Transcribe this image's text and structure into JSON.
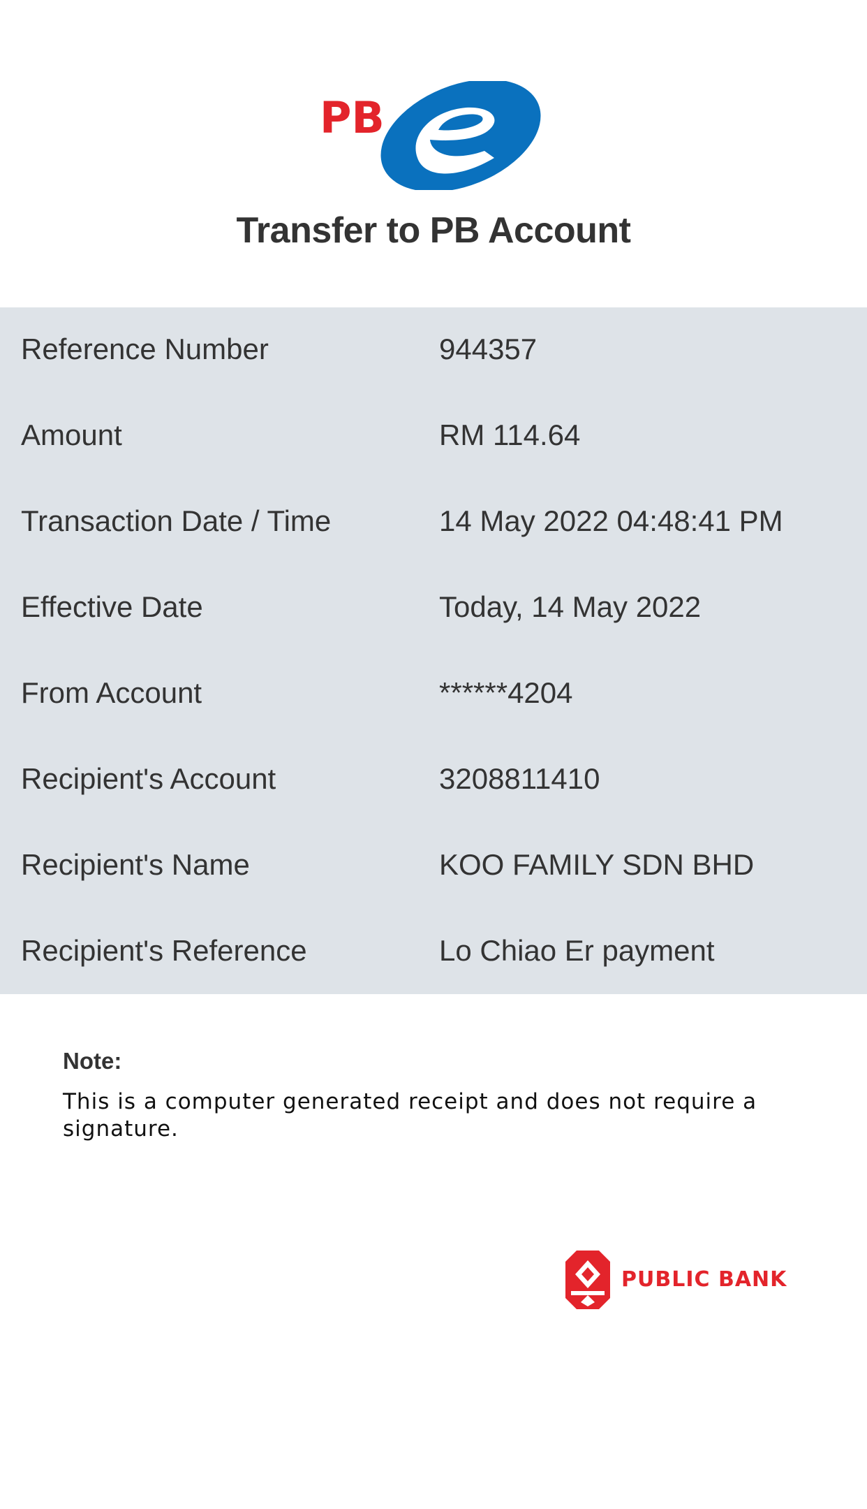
{
  "header": {
    "logo_text": "PBe",
    "title": "Transfer to PB Account"
  },
  "details": [
    {
      "label": "Reference Number",
      "value": "944357"
    },
    {
      "label": "Amount",
      "value": "RM 114.64"
    },
    {
      "label": "Transaction Date / Time",
      "value": "14 May 2022 04:48:41 PM"
    },
    {
      "label": "Effective Date",
      "value": "Today, 14 May 2022"
    },
    {
      "label": "From Account",
      "value": "******4204"
    },
    {
      "label": "Recipient's Account",
      "value": "3208811410"
    },
    {
      "label": "Recipient's Name",
      "value": "KOO FAMILY SDN BHD"
    },
    {
      "label": "Recipient's Reference",
      "value": "Lo Chiao Er payment"
    }
  ],
  "note": {
    "title": "Note:",
    "text": "This is a computer generated receipt and does not require a signature."
  },
  "footer": {
    "bank_name": "PUBLIC BANK"
  },
  "colors": {
    "brand_red": "#e3242b",
    "brand_blue": "#0a71be",
    "panel_background": "#dee3e8",
    "text": "#333333"
  }
}
